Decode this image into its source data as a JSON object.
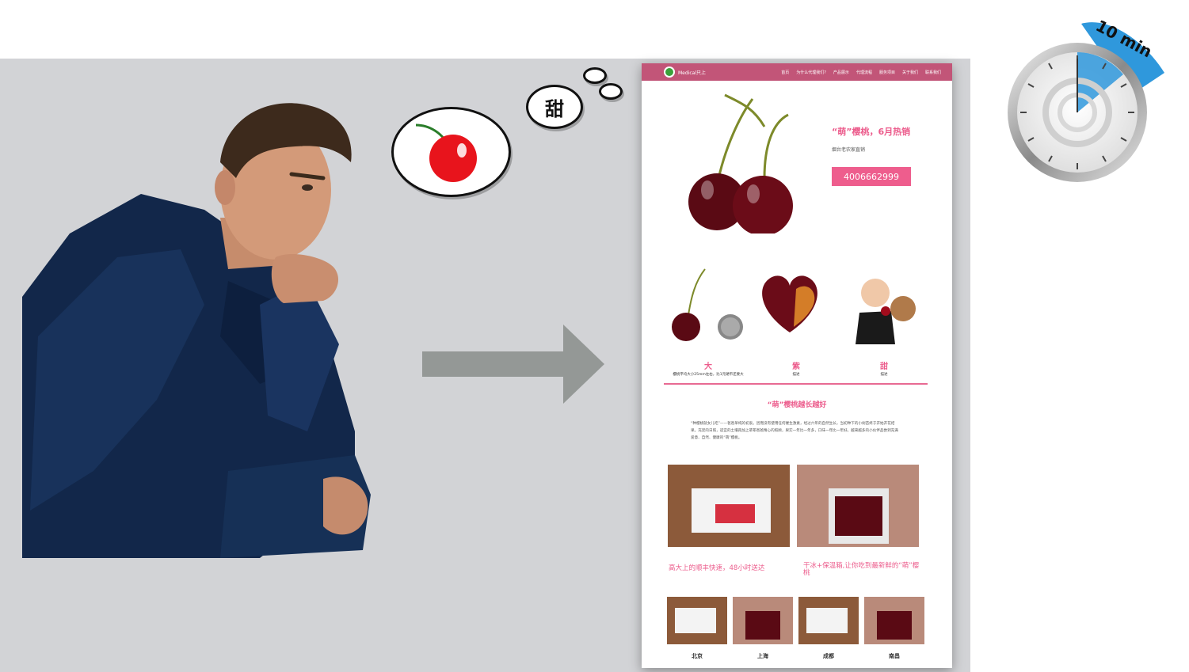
{
  "thought": {
    "word": "甜"
  },
  "site": {
    "brand": "Medical只上",
    "menu": [
      "首页",
      "为什么代理我们?",
      "产品展示",
      "代理流程",
      "服务项目",
      "关于我们",
      "联系我们"
    ],
    "hero": {
      "title": "“萌”樱桃，6月热销",
      "subtitle": "烟台老农家直销",
      "phone": "4006662999"
    },
    "features": [
      {
        "title": "大",
        "desc": "樱桃平均大小25mm左右，比1元硬币还要大"
      },
      {
        "title": "紫",
        "desc": "描述"
      },
      {
        "title": "甜",
        "desc": "描述"
      }
    ],
    "section": {
      "title": "“萌”樱桃越长越好",
      "text": "“种樱桃就女儿吃”——爸爸单纯的初衷。因而没有使用任何催生激素，经过六年的自然生长，当初种下的小树苗终于开始开花结果。充足的日照，适宜的土壤再加上辈辈爸爸精心的照顾，果实一年比一年多，口味一年比一年好。越来越多的小伙伴品尝到充满爱意、自然、健康的“萌”樱桃。"
    },
    "captions": [
      "高大上的顺丰快速，48小时送达",
      "干冰+保温箱,让你吃到最新鲜的“萌”樱桃"
    ],
    "cities": [
      "北京",
      "上海",
      "成都",
      "南昌"
    ]
  },
  "timer": {
    "label": "10 min"
  },
  "colors": {
    "accent": "#ec5c8c",
    "nav": "#c25578",
    "slide_bg": "#d2d3d6",
    "arrow": "#949896",
    "timer_blue": "#2f98dc"
  }
}
